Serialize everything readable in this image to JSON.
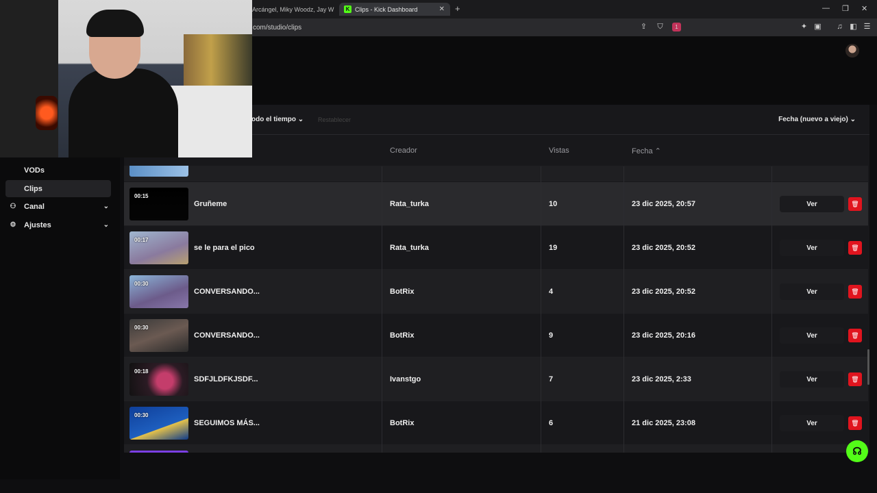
{
  "browser": {
    "tab1_title": "Arcángel, Miky Woodz, Jay Whee",
    "tab2_title": "Clips - Kick Dashboard",
    "url": "com/studio/clips",
    "ext_badge": "1"
  },
  "filters": {
    "time_label": "odo el tiempo",
    "reset_label": "Restablecer",
    "sort_label": "Fecha (nuevo a viejo)"
  },
  "table": {
    "col_creator": "Creador",
    "col_views": "Vistas",
    "col_date": "Fecha",
    "view_label": "Ver",
    "rows": [
      {
        "duration": "00:15",
        "title": "Gruñeme",
        "creator": "Rata_turka",
        "views": "10",
        "date": "23 dic 2025, 20:57"
      },
      {
        "duration": "00:17",
        "title": "se le para el pico",
        "creator": "Rata_turka",
        "views": "19",
        "date": "23 dic 2025, 20:52"
      },
      {
        "duration": "00:30",
        "title": "CONVERSANDO...",
        "creator": "BotRix",
        "views": "4",
        "date": "23 dic 2025, 20:52"
      },
      {
        "duration": "00:30",
        "title": "CONVERSANDO...",
        "creator": "BotRix",
        "views": "9",
        "date": "23 dic 2025, 20:16"
      },
      {
        "duration": "00:18",
        "title": "SDFJLDFKJSDF...",
        "creator": "Ivanstgo",
        "views": "7",
        "date": "23 dic 2025, 2:33"
      },
      {
        "duration": "00:30",
        "title": "SEGUIMOS MÁS...",
        "creator": "BotRix",
        "views": "6",
        "date": "21 dic 2025, 23:08"
      }
    ]
  },
  "sidebar": {
    "items": [
      {
        "label": "VODs"
      },
      {
        "label": "Clips"
      },
      {
        "label": "Canal"
      },
      {
        "label": "Ajustes"
      }
    ]
  },
  "colors": {
    "accent": "#53fc18",
    "danger": "#e0141e",
    "background": "#0e0e10"
  }
}
